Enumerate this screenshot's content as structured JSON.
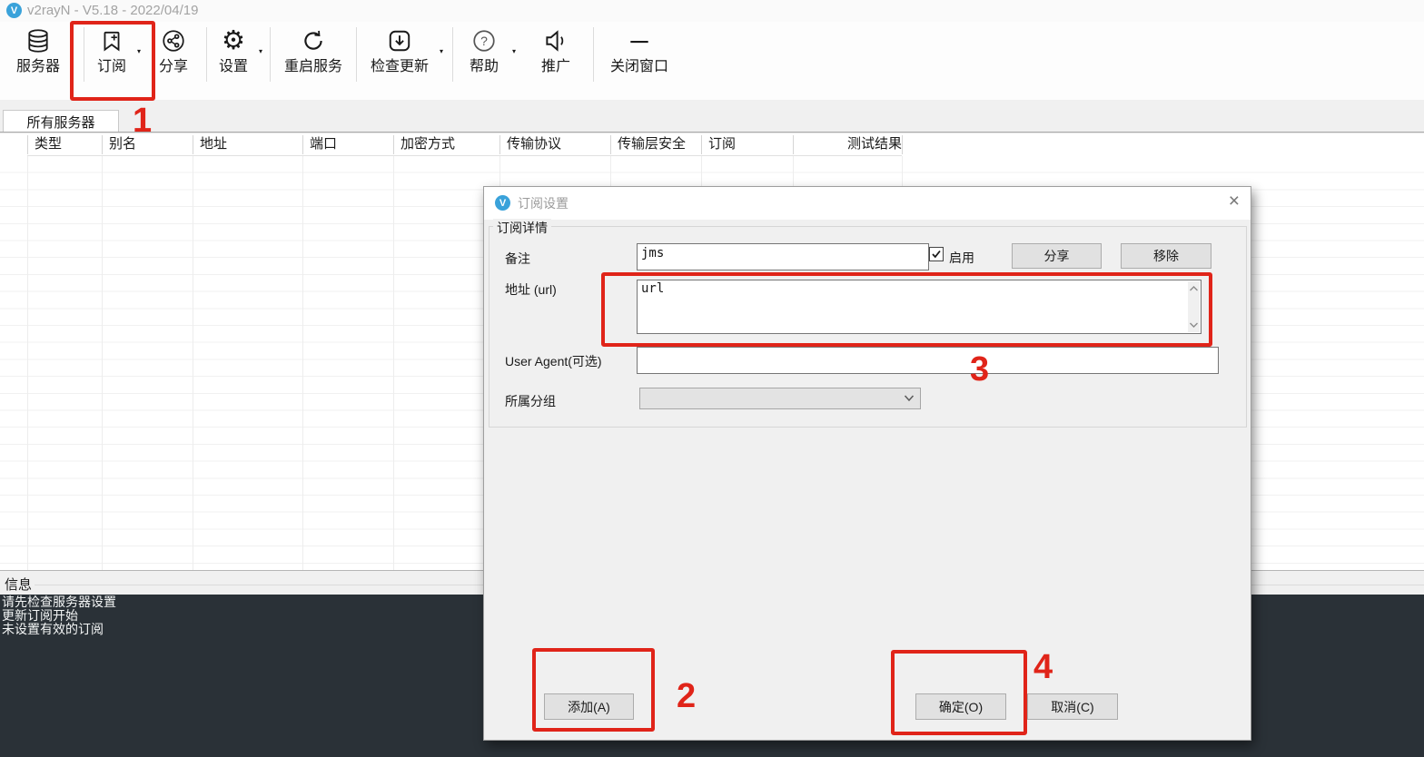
{
  "window": {
    "title": "v2rayN - V5.18 - 2022/04/19"
  },
  "toolbar": {
    "items": [
      {
        "label": "服务器"
      },
      {
        "label": "订阅"
      },
      {
        "label": "分享"
      },
      {
        "label": "设置"
      },
      {
        "label": "重启服务"
      },
      {
        "label": "检查更新"
      },
      {
        "label": "帮助"
      },
      {
        "label": "推广"
      },
      {
        "label": "关闭窗口"
      }
    ]
  },
  "tabs": {
    "all_servers": "所有服务器"
  },
  "table": {
    "headers": [
      "类型",
      "别名",
      "地址",
      "端口",
      "加密方式",
      "传输协议",
      "传输层安全",
      "订阅",
      "测试结果"
    ]
  },
  "info": {
    "label": "信息"
  },
  "log": {
    "messages": [
      "请先检查服务器设置",
      "更新订阅开始",
      "未设置有效的订阅"
    ]
  },
  "dialog": {
    "title": "订阅设置",
    "close_glyph": "×",
    "group_title": "订阅详情",
    "remarks": {
      "label": "备注",
      "value": "jms"
    },
    "enable": {
      "label": "启用"
    },
    "share_button": "分享",
    "remove_button": "移除",
    "url": {
      "label": "地址 (url)",
      "value": "url"
    },
    "user_agent": {
      "label": "User Agent(可选)",
      "value": ""
    },
    "group": {
      "label": "所属分组",
      "value": ""
    },
    "buttons": {
      "add": "添加(A)",
      "ok": "确定(O)",
      "cancel": "取消(C)"
    }
  },
  "annotations": {
    "step1": "1",
    "step2": "2",
    "step3": "3",
    "step4": "4"
  },
  "colors": {
    "annotation": "#e02419",
    "accent_blue": "#3aa2da",
    "console_bg": "#2a3137"
  }
}
